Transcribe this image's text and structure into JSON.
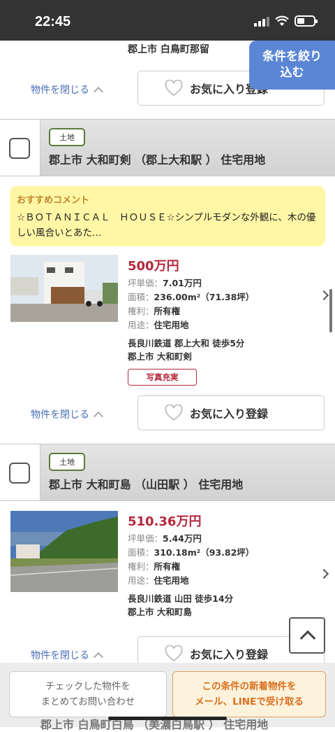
{
  "status_bar": {
    "time": "22:45"
  },
  "top": {
    "address": "郡上市 白鳥町那留",
    "filter_button_line1": "条件を絞り",
    "filter_button_line2": "込む"
  },
  "close_label": "物件を閉じる",
  "fav_label": "お気に入り登録",
  "listings": [
    {
      "tag": "土地",
      "title": "郡上市 大和町剣 （郡上大和駅 ） 住宅用地",
      "recommend_label": "おすすめコメント",
      "recommend_text": "☆ＢＯＴＡＮＩＣＡＬ　ＨＯＵＳＥ☆シンプルモダンな外観に、木の優しい風合いとあた…",
      "price": "500万円",
      "specs": [
        {
          "key": "坪単価：",
          "value": "7.01万円"
        },
        {
          "key": "面積：",
          "value": "236.00m²（71.38坪）"
        },
        {
          "key": "権利：",
          "value": "所有権"
        },
        {
          "key": "用途：",
          "value": "住宅用地"
        }
      ],
      "access": "長良川鉄道 郡上大和 徒歩5分",
      "address": "郡上市 大和町剣",
      "badge": "写真充実"
    },
    {
      "tag": "土地",
      "title": "郡上市 大和町島 （山田駅 ） 住宅用地",
      "price": "510.36万円",
      "specs": [
        {
          "key": "坪単価：",
          "value": "5.44万円"
        },
        {
          "key": "面積：",
          "value": "310.18m²（93.82坪）"
        },
        {
          "key": "権利：",
          "value": "所有権"
        },
        {
          "key": "用途：",
          "value": "住宅用地"
        }
      ],
      "access": "長良川鉄道 山田 徒歩14分",
      "address": "郡上市 大和町島"
    }
  ],
  "next_peek": "郡上市 白鳥町白鳥 （美濃白鳥駅 ） 住宅用地",
  "bottom_bar": {
    "inquiry_line1": "チェックした物件を",
    "inquiry_line2": "まとめてお問い合わせ",
    "line_line1": "この条件の新着物件を",
    "line_line2": "メール、LINEで受け取る"
  }
}
